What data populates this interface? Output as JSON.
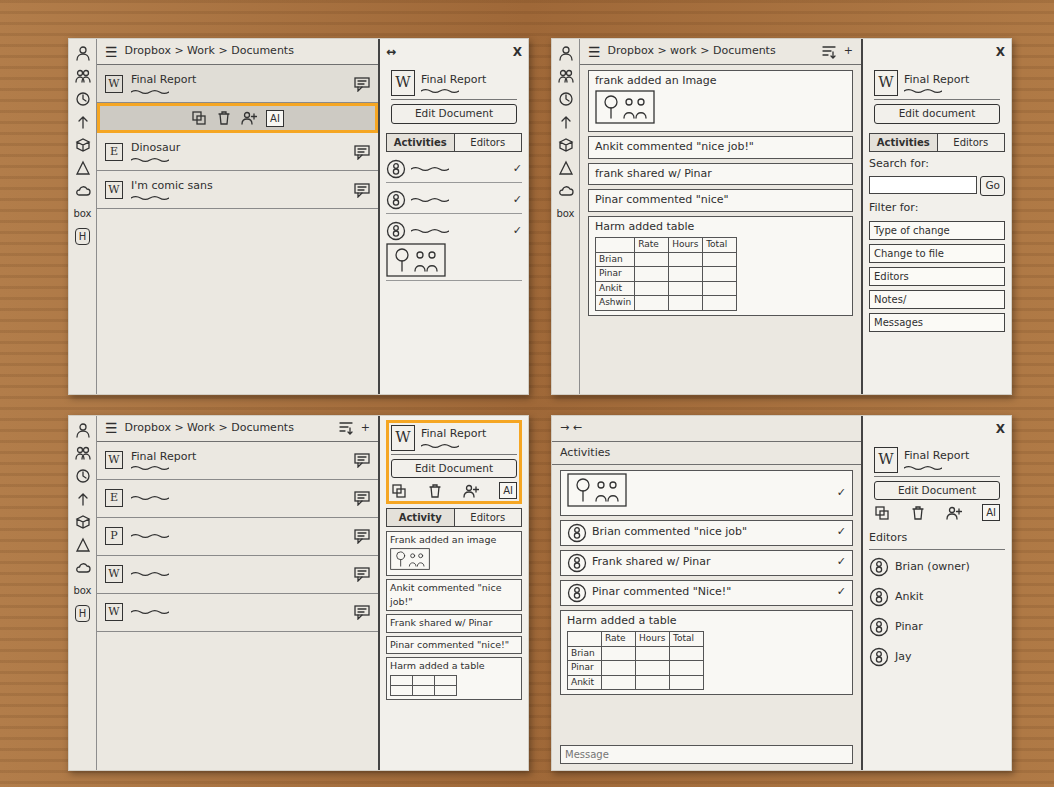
{
  "sketches": [
    {
      "topbar": {
        "menu": "☰",
        "breadcrumb": "Dropbox > Work > Documents"
      },
      "sidebar": [
        "box",
        "H"
      ],
      "main": {
        "files": [
          {
            "badge": "W",
            "name": "Final Report",
            "selected": true
          },
          {
            "badge": "E",
            "name": "Dinosaur",
            "selected": false
          },
          {
            "badge": "W",
            "name": "I'm comic sans",
            "selected": false
          }
        ],
        "file_actions": {
          "label": "AI",
          "highlighted": true
        }
      },
      "drawer": {
        "back": "↔",
        "close": "X",
        "badge": "W",
        "title": "Final Report",
        "button": "Edit Document",
        "tabs": [
          {
            "label": "Activities",
            "selected": true
          },
          {
            "label": "Editors",
            "selected": false
          }
        ],
        "items": [
          {
            "kind": "line",
            "check": "✓"
          },
          {
            "kind": "line",
            "check": "✓"
          },
          {
            "kind": "image",
            "check": "✓"
          }
        ]
      }
    },
    {
      "topbar": {
        "menu": "☰",
        "breadcrumb": "Dropbox > work > Documents",
        "actions": [
          "+"
        ]
      },
      "sidebar": [
        "box"
      ],
      "main": {
        "feed": [
          {
            "kind": "image",
            "text": "frank added an Image"
          },
          {
            "kind": "text",
            "text": "Ankit commented \"nice job!\""
          },
          {
            "kind": "text",
            "text": "frank shared w/ Pinar"
          },
          {
            "kind": "text",
            "text": "Pinar commented \"nice\""
          },
          {
            "kind": "table",
            "text": "Harm added table",
            "table": {
              "columns": [
                "",
                "Rate",
                "Hours",
                "Total"
              ],
              "rows": [
                [
                  "Brian",
                  "",
                  "",
                  ""
                ],
                [
                  "Pinar",
                  "",
                  "",
                  ""
                ],
                [
                  "Ankit",
                  "",
                  "",
                  ""
                ],
                [
                  "Ashwin",
                  "",
                  "",
                  ""
                ]
              ]
            }
          }
        ]
      },
      "drawer": {
        "close": "X",
        "badge": "W",
        "title": "Final Report",
        "button": "Edit document",
        "tabs": [
          {
            "label": "Activities",
            "selected": true
          },
          {
            "label": "Editors",
            "selected": false
          }
        ],
        "search": {
          "label": "Search for:",
          "button": "Go"
        },
        "filters": {
          "label": "Filter for:",
          "options": [
            "Type of change",
            "Change to file",
            "Editors",
            "Notes/",
            "Messages"
          ]
        }
      }
    },
    {
      "topbar": {
        "menu": "☰",
        "breadcrumb": "Dropbox > Work > Documents",
        "actions": [
          "+"
        ]
      },
      "sidebar": [
        "box",
        "H"
      ],
      "main": {
        "files": [
          {
            "badge": "W",
            "name": "Final Report",
            "selected": false
          },
          {
            "badge": "E",
            "name": "",
            "selected": false
          },
          {
            "badge": "P",
            "name": "",
            "selected": false
          },
          {
            "badge": "W",
            "name": "",
            "selected": false
          },
          {
            "badge": "W",
            "name": "",
            "selected": false
          }
        ]
      },
      "drawer": {
        "badge": "W",
        "title": "Final Report",
        "button": "Edit Document",
        "actions": {
          "label": "AI",
          "highlighted": true
        },
        "tabs": [
          {
            "label": "Activity",
            "selected": true
          },
          {
            "label": "Editors",
            "selected": false
          }
        ],
        "feed": [
          {
            "kind": "image",
            "text": "Frank added an image"
          },
          {
            "kind": "text",
            "text": "Ankit commented \"nice job!\""
          },
          {
            "kind": "text",
            "text": "Frank shared w/ Pinar"
          },
          {
            "kind": "text",
            "text": "Pinar commented \"nice!\""
          },
          {
            "kind": "table",
            "text": "Harm added a table",
            "table": {
              "columns": [
                "",
                "",
                ""
              ],
              "rows": [
                [
                  "",
                  "",
                  ""
                ]
              ]
            }
          }
        ]
      }
    },
    {
      "topbar": {
        "nav": "→ ←"
      },
      "main": {
        "heading": "Activities",
        "feed": [
          {
            "kind": "image",
            "check": "✓"
          },
          {
            "kind": "comment",
            "text": "Brian commented \"nice job\"",
            "check": "✓"
          },
          {
            "kind": "comment",
            "text": "Frank shared w/ Pinar",
            "check": "✓"
          },
          {
            "kind": "comment",
            "text": "Pinar commented \"Nice!\"",
            "check": "✓"
          },
          {
            "kind": "table",
            "text": "Harm added a table",
            "table": {
              "columns": [
                "",
                "Rate",
                "Hours",
                "Total"
              ],
              "rows": [
                [
                  "Brian",
                  "",
                  "",
                  ""
                ],
                [
                  "Pinar",
                  "",
                  "",
                  ""
                ],
                [
                  "Ankit",
                  "",
                  "",
                  ""
                ]
              ]
            }
          }
        ],
        "input": "Message"
      },
      "drawer": {
        "close": "X",
        "badge": "W",
        "title": "Final Report",
        "button": "Edit Document",
        "actions": {
          "label": "AI",
          "highlighted": false
        },
        "editors": {
          "title": "Editors",
          "people": [
            "Brian (owner)",
            "Ankit",
            "Pinar",
            "Jay"
          ]
        }
      }
    }
  ]
}
